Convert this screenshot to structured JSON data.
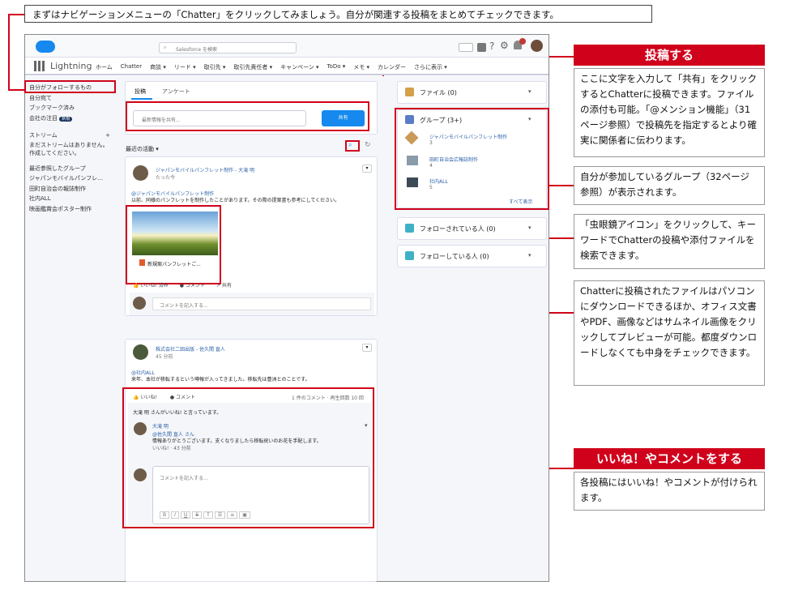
{
  "top_caption": "まずはナビゲーションメニューの「Chatter」をクリックしてみましょう。自分が関連する投稿をまとめてチェックできます。",
  "header": {
    "search_placeholder": "Salesforce を検索",
    "app_name": "Lightning",
    "nav": [
      "ホーム",
      "Chatter",
      "商談 ▾",
      "リード ▾",
      "取引先 ▾",
      "取引先責任者 ▾",
      "キャンペーン ▾",
      "ToDo ▾",
      "メモ ▾",
      "カレンダー",
      "さらに表示 ▾"
    ]
  },
  "sidebar": {
    "items": [
      "自分がフォローするもの",
      "自分宛て",
      "ブックマーク済み",
      "会社の注目"
    ],
    "badge": "新規",
    "stream_title": "ストリーム",
    "stream_add": "+",
    "stream_empty": "まだストリームはありません。作成してください。",
    "groups_title": "最近参照したグループ",
    "groups": [
      "ジャパンモバイルパンフレ…",
      "田町自治会の報誌制作",
      "社内ALL",
      "映画鑑賞会ポスター制作"
    ]
  },
  "composer": {
    "tabs": [
      "投稿",
      "アンケート"
    ],
    "placeholder": "最新情報を共有...",
    "share_button": "共有"
  },
  "feed": {
    "sort_label": "最近の活動 ▾",
    "post1": {
      "author": "ジャパンモバイルパンフレット制作 - 大滝 明",
      "time": "たった今",
      "mention": "@ジャパンモバイルパンフレット制作",
      "body": "以前、同様のパンフレットを制作したことがあります。その際の提案書も参考にしてください。",
      "file_name": "新規案パンフレットご...",
      "actions": [
        "いいね! 済み",
        "コメント",
        "共有"
      ],
      "comment_placeholder": "コメントを記入する..."
    },
    "post2": {
      "author": "株式会社二田出版 - 佐久間 直人",
      "time": "45 分前",
      "mention": "@社内ALL",
      "body": "来年、本社が移転するという噂報が入ってきました。移転先は豊洲とのことです。",
      "actions": [
        "いいね!",
        "コメント"
      ],
      "stats": "1 件のコメント · 再生回数 10 回",
      "liked_by": "大滝 明 さんがいいね! と言っています。",
      "comment_author": "大滝 明",
      "comment_mention": "@佐久間 直人 さん",
      "comment_body": "情報ありがとうございます。支くなりましたら移転祝いのお花を手配します。",
      "comment_meta": "いいね! · 43 分前",
      "comment_placeholder": "コメントを記入する..."
    }
  },
  "right_panel": {
    "files": "ファイル (0)",
    "groups_title": "グループ (3+)",
    "groups": [
      {
        "name": "ジャパンモバイルパンフレット制作",
        "count": "3"
      },
      {
        "name": "田町自治会広報誌制作",
        "count": "4"
      },
      {
        "name": "社内ALL",
        "count": "5"
      }
    ],
    "view_all": "すべて表示",
    "followers": "フォローされている人 (0)",
    "following": "フォローしている人 (0)"
  },
  "callouts": {
    "post_title": "投稿する",
    "post_text": "ここに文字を入力して「共有」をクリックするとChatterに投稿できます。ファイルの添付も可能。「@メンション機能」（31ページ参照）で投稿先を指定するとより確実に関係者に伝わります。",
    "groups_text": "自分が参加しているグループ（32ページ参照）が表示されます。",
    "search_text": "「虫眼鏡アイコン」をクリックして、キーワードでChatterの投稿や添付ファイルを検索できます。",
    "file_text": "Chatterに投稿されたファイルはパソコンにダウンロードできるほか、オフィス文書やPDF、画像などはサムネイル画像をクリックしてプレビューが可能。都度ダウンロードしなくても中身をチェックできます。",
    "like_title": "いいね！やコメントをする",
    "like_text": "各投稿にはいいね！やコメントが付けられます。"
  },
  "colors": {
    "accent": "#d0021b",
    "salesforce_blue": "#1589ee",
    "link": "#2a5fa8"
  }
}
